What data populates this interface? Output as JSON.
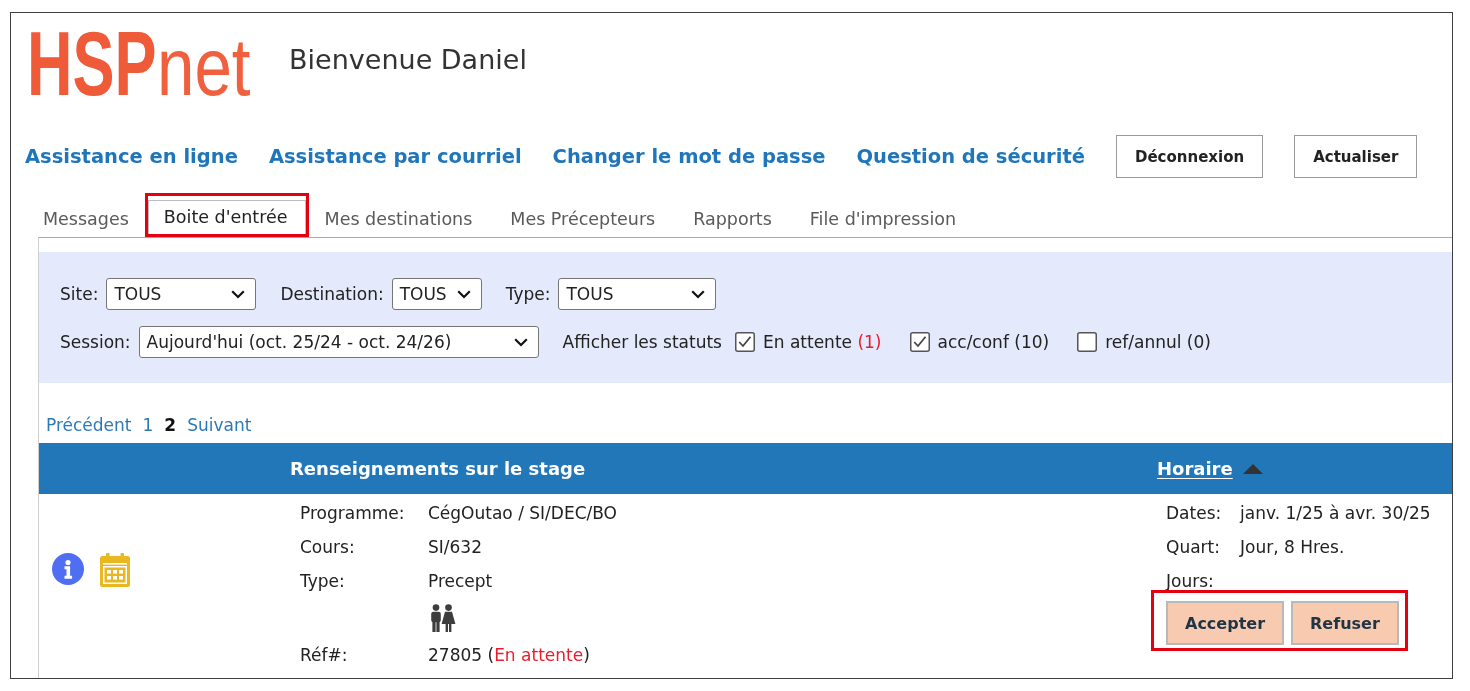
{
  "header": {
    "logo": {
      "mark": "HSP",
      "suffix": "net"
    },
    "welcome": "Bienvenue Daniel"
  },
  "links": [
    "Assistance en ligne",
    "Assistance par courriel",
    "Changer le mot de passe",
    "Question de sécurité"
  ],
  "buttons": [
    "Déconnexion",
    "Actualiser"
  ],
  "tabs": [
    {
      "label": "Messages",
      "selected": false,
      "highlighted": false
    },
    {
      "label": "Boite d'entrée",
      "selected": true,
      "highlighted": true
    },
    {
      "label": "Mes destinations",
      "selected": false,
      "highlighted": false
    },
    {
      "label": "Mes Précepteurs",
      "selected": false,
      "highlighted": false
    },
    {
      "label": "Rapports",
      "selected": false,
      "highlighted": false
    },
    {
      "label": "File d'impression",
      "selected": false,
      "highlighted": false
    }
  ],
  "filters": {
    "selects": [
      {
        "label": "Site:",
        "value": "TOUS"
      },
      {
        "label": "Destination:",
        "value": "TOUS"
      },
      {
        "label": "Type:",
        "value": "TOUS"
      }
    ],
    "session": {
      "label": "Session:",
      "value": "Aujourd'hui (oct. 25/24 - oct. 24/26)"
    },
    "status_label": "Afficher les statuts",
    "statuses": [
      {
        "label": "En attente",
        "count": "(1)",
        "checked": true,
        "alert": true
      },
      {
        "label": "acc/conf",
        "count": "(10)",
        "checked": true,
        "alert": false
      },
      {
        "label": "ref/annul",
        "count": "(0)",
        "checked": false,
        "alert": false
      }
    ]
  },
  "pagination": [
    {
      "label": "Précédent",
      "selected": false
    },
    {
      "label": "1",
      "selected": false
    },
    {
      "label": "2",
      "selected": true
    },
    {
      "label": "Suivant",
      "selected": false
    }
  ],
  "table": {
    "columns": [
      {
        "label": "Renseignements sur le stage",
        "sorted": false
      },
      {
        "label": "Horaire",
        "sorted": true
      }
    ],
    "rows": [
      {
        "details": [
          {
            "kind": "field",
            "label": "Programme:",
            "value": "CégOutao / SI/DEC/BO"
          },
          {
            "kind": "field",
            "label": "Cours:",
            "value": "SI/632"
          },
          {
            "kind": "field",
            "label": "Type:",
            "value": "Precept"
          },
          {
            "kind": "people-icon"
          },
          {
            "kind": "reference",
            "label": "Réf#:",
            "value": "27805 (",
            "status": "En attente",
            "suffix": ")"
          }
        ],
        "schedule": [
          {
            "label": "Dates:",
            "value": "janv. 1/25 à avr. 30/25"
          },
          {
            "label": "Quart:",
            "value": "Jour, 8 Hres."
          },
          {
            "label": "Jours:"
          }
        ],
        "actions": {
          "highlighted": true,
          "buttons": [
            "Accepter",
            "Refuser"
          ]
        }
      }
    ]
  }
}
